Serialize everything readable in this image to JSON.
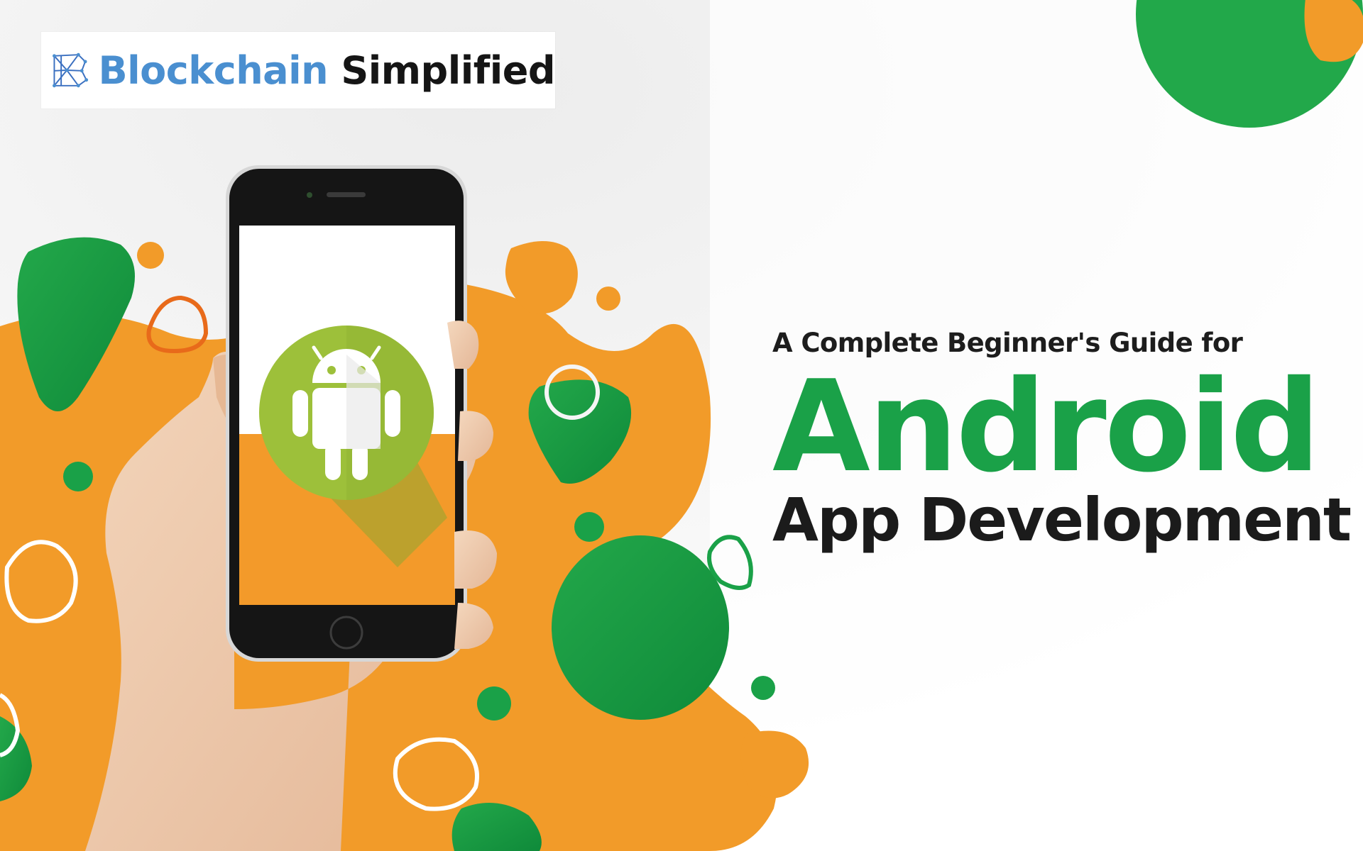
{
  "brand": {
    "name_part1": "Blockchain",
    "name_part2": "Simplified",
    "logo_icon": "blockchain-cube-icon",
    "color_blue": "#4a8fd0"
  },
  "headline": {
    "subtitle": "A Complete Beginner's Guide for",
    "title": "Android",
    "title_line2": "App Development"
  },
  "colors": {
    "green": "#1aa148",
    "orange": "#f29b29",
    "android_green": "#9dc03a",
    "text_dark": "#1b1b1b"
  },
  "phone_screen_icon": "android-robot-icon"
}
